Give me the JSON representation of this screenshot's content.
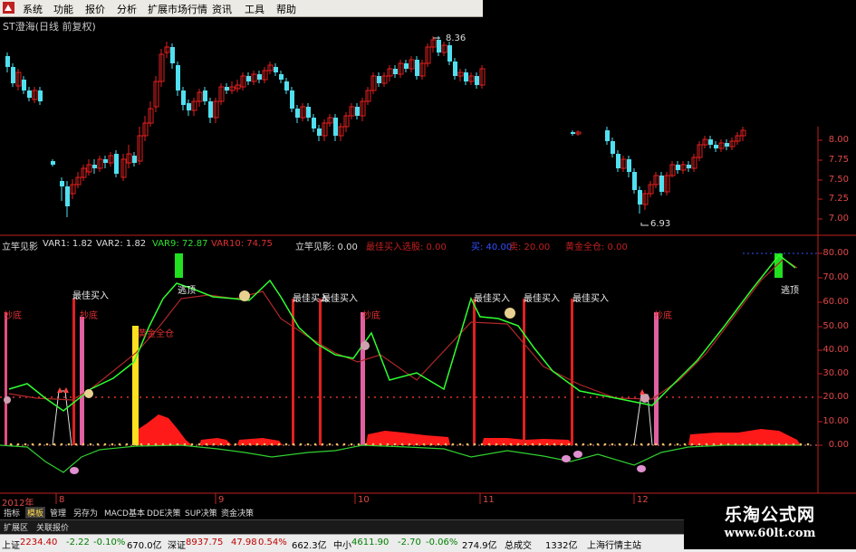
{
  "menubar": {
    "items": [
      "系统",
      "功能",
      "报价",
      "分析",
      "扩展市场行情",
      "资讯",
      "工具",
      "帮助"
    ]
  },
  "stock_title": "ST澄海(日线 前复权)",
  "price_high_label": "8.36",
  "price_low_label": "6.93",
  "price_axis": [
    "8.00",
    "7.75",
    "7.50",
    "7.25",
    "7.00"
  ],
  "indicator_axis": [
    "80.00",
    "70.00",
    "60.00",
    "50.00",
    "40.00",
    "30.00",
    "20.00",
    "10.00",
    "0.00"
  ],
  "indicator_row": {
    "name": "立竿见影",
    "var1": "VAR1: 1.82",
    "var2": "VAR2: 1.82",
    "var9": "VAR9: 72.87",
    "var10": "VAR10: 74.75",
    "lgjy": "立竿见影: 0.00",
    "best_buy": "最佳买入选股: 0.00",
    "buy": "买: 40.00",
    "sell": "卖: 20.00",
    "gold": "黄金全仓: 0.00"
  },
  "signals": {
    "best_buy": "最佳买入",
    "escape": "逃顶",
    "gold_full": "黄金全仓",
    "grab_bottom": "抄底"
  },
  "time_axis": [
    "2012年",
    "8",
    "9",
    "10",
    "11",
    "12"
  ],
  "bottom_tabs": [
    "指标",
    "模板",
    "管理",
    "另存为",
    "MACD基本",
    "DDE决策",
    "SUP决策",
    "资金决策"
  ],
  "sub_tabs": [
    "扩展区",
    "关联报价"
  ],
  "status": {
    "sh_label": "上证",
    "sh_index": "2234.40",
    "sh_change": "-2.22",
    "sh_pct": "-0.10%",
    "sh_amount": "670.0亿",
    "sz_label": "深证",
    "sz_index": "8937.75",
    "sz_change": "47.98",
    "sz_pct": "0.54%",
    "sz_amount": "662.3亿",
    "sme_label": "中小",
    "sme_index": "4611.90",
    "sme_change": "-2.70",
    "sme_pct": "-0.06%",
    "sme_amount": "274.9亿",
    "total_label": "总成交",
    "total_amount": "1332亿",
    "server": "上海行情主站"
  },
  "watermark": {
    "title": "乐淘公式网",
    "url": "www.60lt.com"
  },
  "colors": {
    "up": "#e02020",
    "down": "#50e0f0",
    "green_line": "#30ff30",
    "red_line": "#c03030",
    "yellow": "#ffd800"
  }
}
